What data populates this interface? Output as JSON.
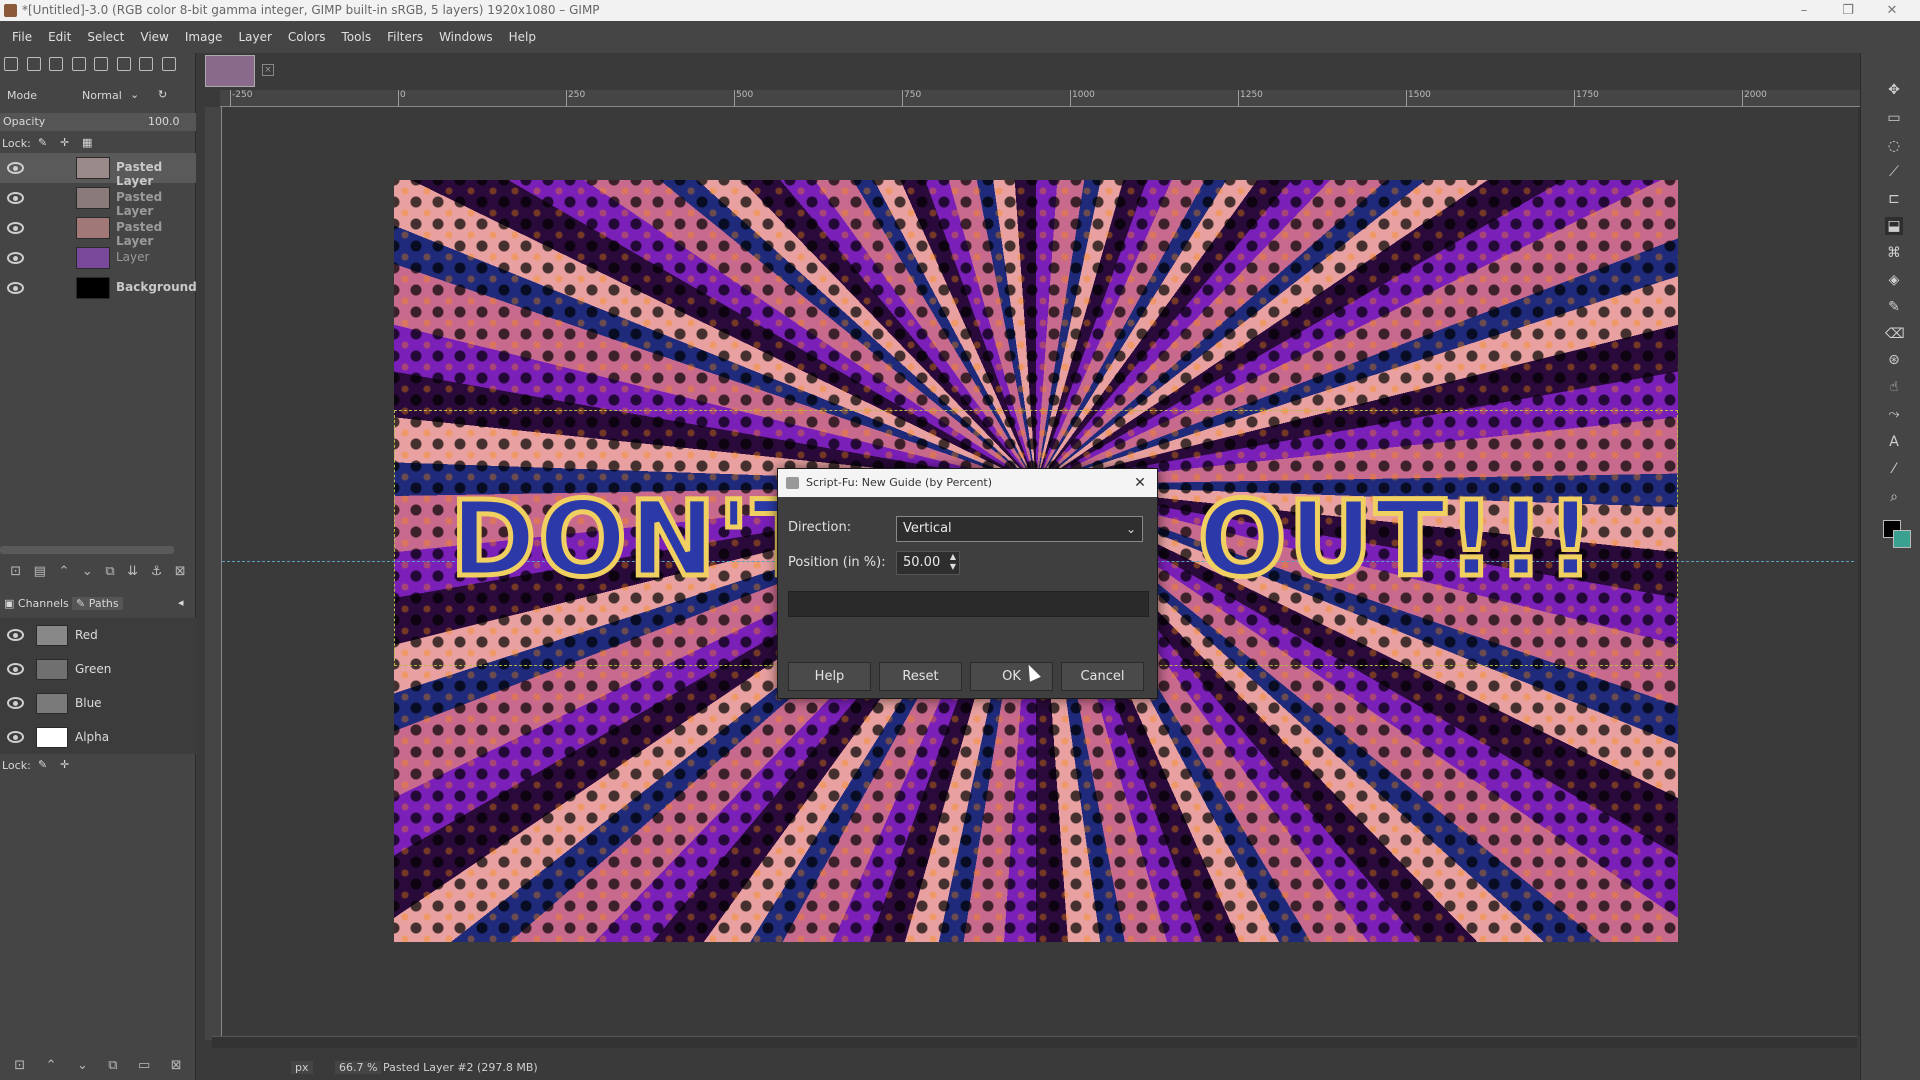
{
  "window": {
    "title": "*[Untitled]-3.0 (RGB color 8-bit gamma integer, GIMP built-in sRGB, 5 layers) 1920x1080 – GIMP"
  },
  "menu": [
    "File",
    "Edit",
    "Select",
    "View",
    "Image",
    "Layer",
    "Colors",
    "Tools",
    "Filters",
    "Windows",
    "Help"
  ],
  "layers_panel": {
    "mode_label": "Mode",
    "mode_value": "Normal",
    "opacity_label": "Opacity",
    "opacity_value": "100.0",
    "lock_label": "Lock:",
    "layers": [
      {
        "name": "Pasted Layer",
        "thumb": "#9a8a8a"
      },
      {
        "name": "Pasted Layer",
        "thumb": "#8a7a7a"
      },
      {
        "name": "Pasted Layer",
        "thumb": "#a07878"
      },
      {
        "name": "Layer",
        "thumb": "#7a4a9a"
      },
      {
        "name": "Background",
        "thumb": "#000000"
      }
    ]
  },
  "channels_panel": {
    "tab_channels": "Channels",
    "tab_paths": "Paths",
    "lock_label": "Lock:",
    "channels": [
      {
        "name": "Red",
        "thumb": "#888888"
      },
      {
        "name": "Green",
        "thumb": "#707070"
      },
      {
        "name": "Blue",
        "thumb": "#7a7a7a"
      },
      {
        "name": "Alpha",
        "thumb": "#ffffff"
      }
    ]
  },
  "ruler": {
    "h_ticks": [
      "-250",
      "0",
      "250",
      "500",
      "750",
      "1000",
      "1250",
      "1500",
      "1750",
      "2000"
    ]
  },
  "canvas": {
    "text_left": "DON'T",
    "text_right": "OUT!!!"
  },
  "dialog": {
    "title": "Script-Fu: New Guide (by Percent)",
    "direction_label": "Direction:",
    "direction_value": "Vertical",
    "position_label": "Position (in %):",
    "position_value": "50.00",
    "buttons": {
      "help": "Help",
      "reset": "Reset",
      "ok": "OK",
      "cancel": "Cancel"
    }
  },
  "status": {
    "unit": "px",
    "zoom": "66.7 %",
    "message": "Pasted Layer #2 (297.8 MB)"
  },
  "colors": {
    "fg": "#000000",
    "bg": "#3aa090"
  }
}
